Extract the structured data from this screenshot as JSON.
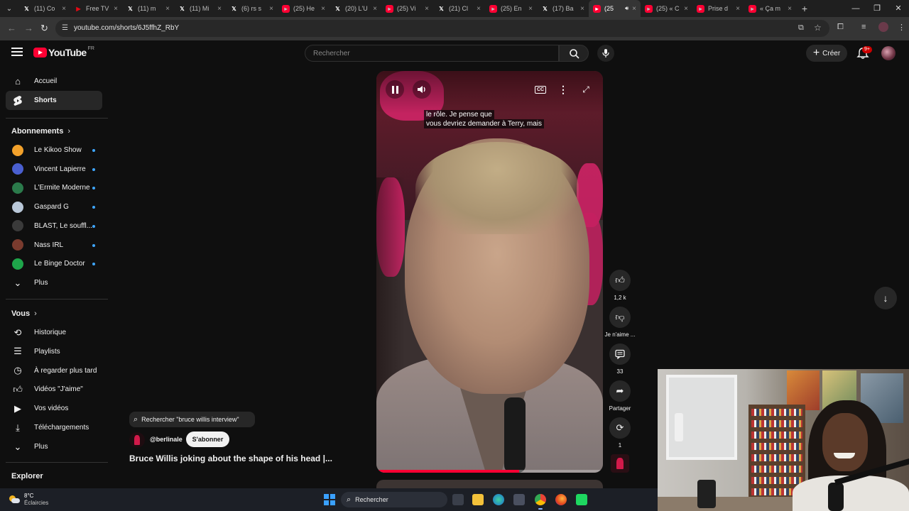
{
  "browser": {
    "tabs": [
      {
        "title": "(11) Co",
        "icon": "x-logo-icon",
        "active": false
      },
      {
        "title": "Free TV",
        "icon": "tv-icon",
        "active": false
      },
      {
        "title": "(11) m",
        "icon": "x-logo-icon",
        "active": false
      },
      {
        "title": "(11) Mi",
        "icon": "x-logo-icon",
        "active": false
      },
      {
        "title": "(6) rs s",
        "icon": "x-logo-icon",
        "active": false
      },
      {
        "title": "(25) He",
        "icon": "youtube-icon",
        "active": false
      },
      {
        "title": "(20) L'U",
        "icon": "x-logo-icon",
        "active": false
      },
      {
        "title": "(25) Vi",
        "icon": "youtube-icon",
        "active": false
      },
      {
        "title": "(21) Cl",
        "icon": "x-logo-icon",
        "active": false
      },
      {
        "title": "(25) En",
        "icon": "youtube-icon",
        "active": false
      },
      {
        "title": "(17) Ba",
        "icon": "x-logo-icon",
        "active": false
      },
      {
        "title": "(25",
        "icon": "youtube-icon",
        "active": true
      },
      {
        "title": "(25) « C",
        "icon": "youtube-icon",
        "active": false
      },
      {
        "title": "Prise d",
        "icon": "youtube-icon",
        "active": false
      },
      {
        "title": "« Ça m",
        "icon": "youtube-icon",
        "active": false
      }
    ],
    "url": "youtube.com/shorts/6J5ffhZ_RbY"
  },
  "header": {
    "logo_text": "YouTube",
    "logo_region": "FR",
    "search_placeholder": "Rechercher",
    "create_label": "Créer",
    "notif_badge": "9+"
  },
  "sidebar": {
    "top_items": [
      {
        "label": "Accueil",
        "icon": "home-icon",
        "active": false
      },
      {
        "label": "Shorts",
        "icon": "shorts-icon",
        "active": true
      }
    ],
    "subscriptions_title": "Abonnements",
    "subscriptions": [
      {
        "label": "Le Kikoo Show",
        "avatar_color": "#f2a12b"
      },
      {
        "label": "Vincent Lapierre",
        "avatar_color": "#4a5fd0"
      },
      {
        "label": "L'Ermite Moderne",
        "avatar_color": "#2b7a4b"
      },
      {
        "label": "Gaspard G",
        "avatar_color": "#b9c7d8"
      },
      {
        "label": "BLAST, Le souffl...",
        "avatar_color": "#3a3a3a"
      },
      {
        "label": "Nass IRL",
        "avatar_color": "#7a3b2e"
      },
      {
        "label": "Le Binge Doctor",
        "avatar_color": "#1ea54a"
      }
    ],
    "more_label": "Plus",
    "you_title": "Vous",
    "you_items": [
      {
        "label": "Historique",
        "icon": "history-icon"
      },
      {
        "label": "Playlists",
        "icon": "playlists-icon"
      },
      {
        "label": "À regarder plus tard",
        "icon": "watch-later-icon"
      },
      {
        "label": "Vidéos \"J'aime\"",
        "icon": "liked-videos-icon"
      },
      {
        "label": "Vos vidéos",
        "icon": "your-videos-icon"
      },
      {
        "label": "Téléchargements",
        "icon": "downloads-icon"
      }
    ],
    "you_more_label": "Plus",
    "explore_title": "Explorer"
  },
  "short": {
    "subtitle_line1": "le rôle. Je pense que",
    "subtitle_line2": "vous devriez demander à Terry, mais",
    "progress_fraction": 0.63,
    "search_chip": "Rechercher \"bruce willis interview\"",
    "channel": "@berlinale",
    "subscribe_label": "S'abonner",
    "title": "Bruce Willis joking about the shape of his head |..."
  },
  "actions": {
    "like_count": "1,2 k",
    "dislike_label": "Je n'aime ...",
    "comments_count": "33",
    "share_label": "Partager",
    "remix_count": "1"
  },
  "taskbar": {
    "weather_temp": "8°C",
    "weather_desc": "Éclaircies",
    "search_label": "Rechercher"
  }
}
